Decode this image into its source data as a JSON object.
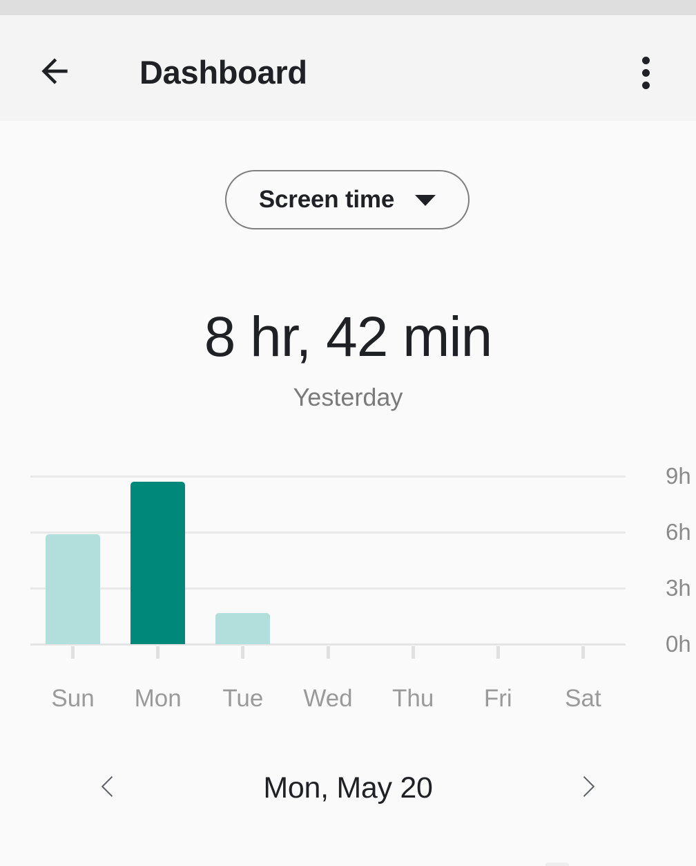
{
  "status_bar": {
    "background": "#dedede"
  },
  "app_bar": {
    "title": "Dashboard",
    "back_icon": "arrow-back-icon",
    "overflow_icon": "more-vert-icon",
    "background": "#f4f4f4"
  },
  "filter_chip": {
    "label": "Screen time",
    "dropdown_icon": "chevron-down-icon"
  },
  "summary": {
    "value": "8 hr, 42 min",
    "subtitle": "Yesterday"
  },
  "date_nav": {
    "prev_icon": "chevron-left-icon",
    "next_icon": "chevron-right-icon",
    "current": "Mon, May 20"
  },
  "colors": {
    "page_background": "#fafafa",
    "bar_selected": "#00897b",
    "bar_default": "#b2dfdb",
    "gridline": "#e9e9e9",
    "label_gray": "#9a9a9a",
    "text_primary": "#202124"
  },
  "chart_data": {
    "type": "bar",
    "title": "",
    "xlabel": "",
    "ylabel": "",
    "categories": [
      "Sun",
      "Mon",
      "Tue",
      "Wed",
      "Thu",
      "Fri",
      "Sat"
    ],
    "values": [
      5.9,
      8.7,
      1.65,
      0,
      0,
      0,
      0
    ],
    "value_labels": [
      "5 hr, 54 min",
      "8 hr, 42 min",
      "1 hr, 39 min",
      "0",
      "0",
      "0",
      "0"
    ],
    "selected_index": 1,
    "ylim": [
      0,
      9
    ],
    "ytick_values": [
      0,
      3,
      6,
      9
    ],
    "ytick_labels": [
      "0h",
      "3h",
      "6h",
      "9h"
    ],
    "grid": true,
    "legend": false,
    "series": [
      {
        "name": "Screen time",
        "values": [
          5.9,
          8.7,
          1.65,
          0,
          0,
          0,
          0
        ]
      }
    ]
  }
}
